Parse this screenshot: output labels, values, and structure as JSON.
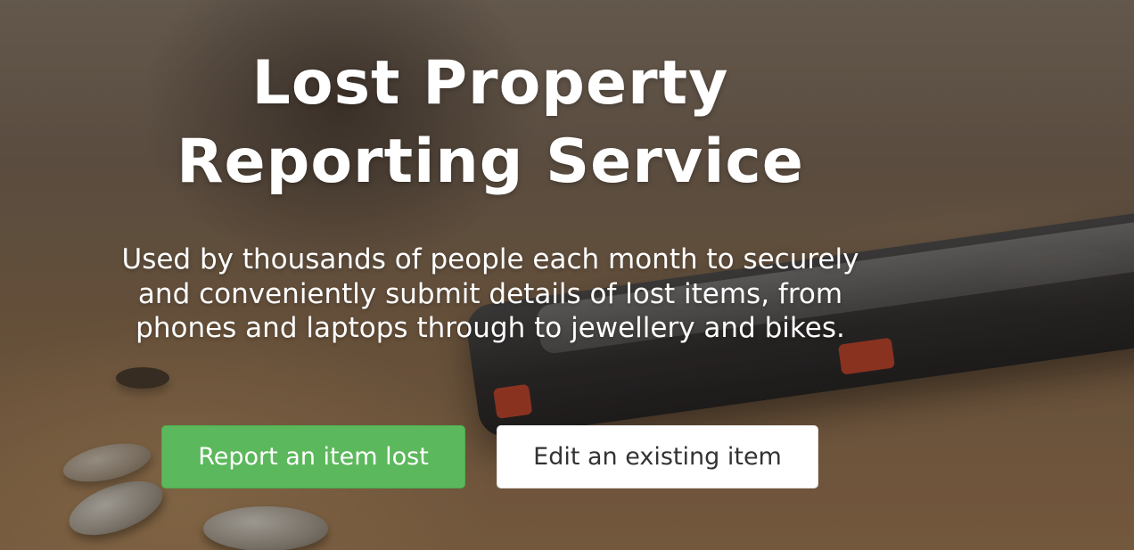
{
  "hero": {
    "title_line1": "Lost Property",
    "title_line2": "Reporting Service",
    "subtitle": "Used by thousands of people each month to securely and conveniently submit details of lost items, from phones and laptops through to jewellery and bikes."
  },
  "actions": {
    "report_label": "Report an item lost",
    "edit_label": "Edit an existing item"
  },
  "colors": {
    "primary_button": "#5cb85c",
    "secondary_button": "#ffffff",
    "title_text": "#ffffff"
  },
  "background_image": "phone-on-sandy-beach"
}
